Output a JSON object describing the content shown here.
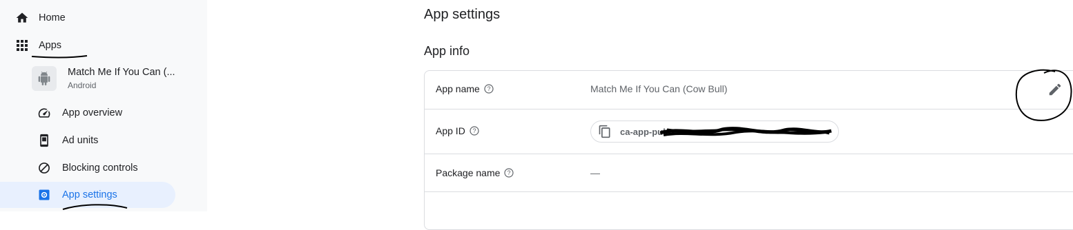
{
  "sidebar": {
    "home_label": "Home",
    "apps_label": "Apps",
    "app": {
      "name": "Match Me If You Can (...",
      "platform": "Android"
    },
    "items": [
      {
        "label": "App overview",
        "icon": "speedometer-icon"
      },
      {
        "label": "Ad units",
        "icon": "phone-icon"
      },
      {
        "label": "Blocking controls",
        "icon": "block-icon"
      },
      {
        "label": "App settings",
        "icon": "settings-icon",
        "active": true
      }
    ]
  },
  "main": {
    "page_title": "App settings",
    "section_title": "App info",
    "rows": [
      {
        "label": "App name",
        "value": "Match Me If You Can (Cow Bull)"
      },
      {
        "label": "App ID",
        "value": "ca-app-pub-"
      },
      {
        "label": "Package name",
        "value": "—"
      },
      {
        "label": "",
        "value": ""
      }
    ]
  },
  "colors": {
    "accent": "#1a73e8",
    "active_bg": "#e8f0fe",
    "border": "#dadce0",
    "annotation": "#000000"
  }
}
